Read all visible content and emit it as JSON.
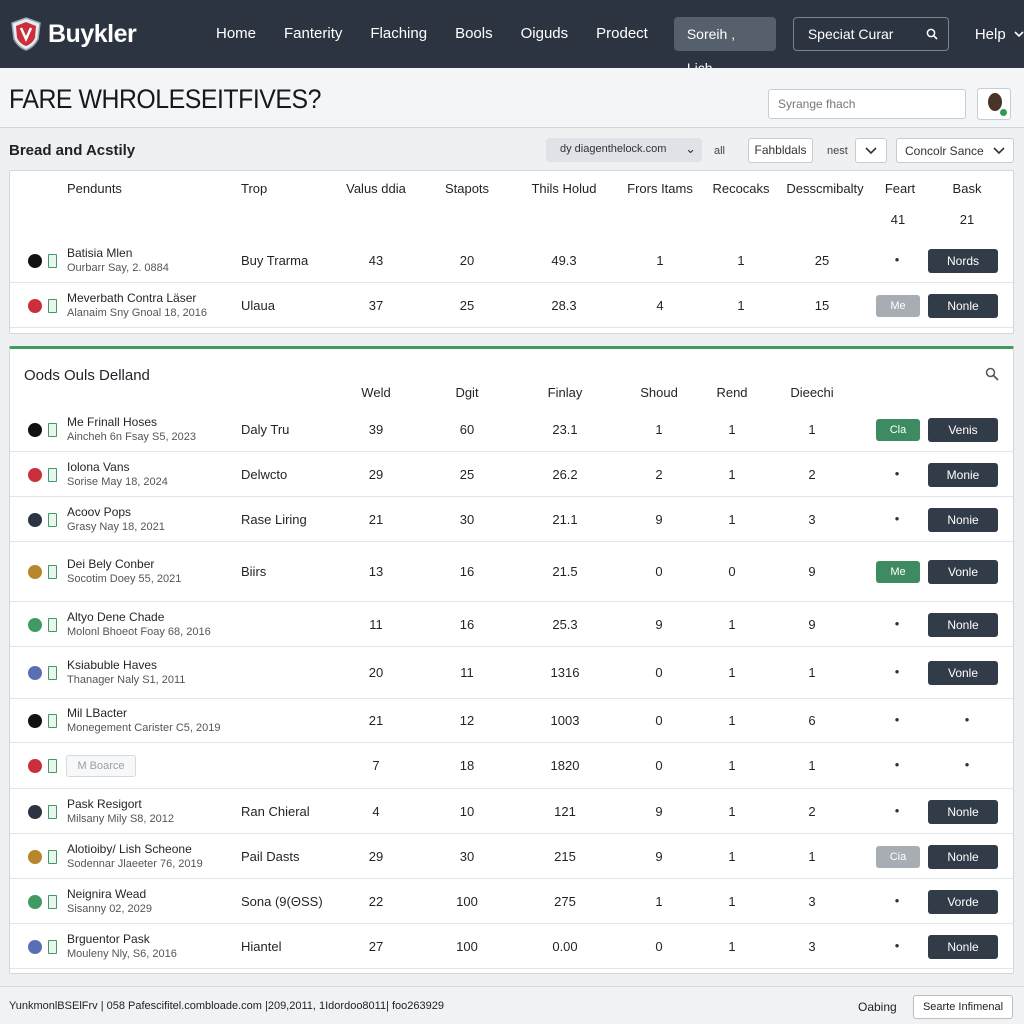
{
  "app": {
    "logo_text": "Buykler"
  },
  "nav": {
    "items": [
      "Home",
      "Fanterity",
      "Flaching",
      "Bools",
      "Oiguds",
      "Prodect"
    ],
    "search_pill": "Soreih , Lich",
    "search_box": "Speciat Curar",
    "help": "Help"
  },
  "header": {
    "title": "FARE WHROLESEITFIVES?",
    "search_placeholder": "Syrange fhach"
  },
  "toolbar": {
    "section_title": "Bread and Acstily",
    "filter_value": "dy diagenthelock.com",
    "label_all": "all",
    "btn_filters": "Fahbldals",
    "label_next": "nest",
    "dropdown_value": "Concolr Sance"
  },
  "table1": {
    "headers": [
      "Pendunts",
      "Trop",
      "Valus ddia",
      "Stapots",
      "Thils Holud",
      "Frors Itams",
      "Recocaks",
      "Desscmibalty",
      "Feart",
      "Bask"
    ],
    "totals": [
      "41",
      "21"
    ],
    "rows": [
      {
        "name": "Batisia Mlen",
        "sub": "Ourbarr Say, 2. 0884",
        "trop": "Buy Trarma",
        "c1": "43",
        "c2": "20",
        "c3": "49.3",
        "c4": "1",
        "c5": "1",
        "c6": "25",
        "mark": "•",
        "tag": "",
        "action": "Nords"
      },
      {
        "name": "Meverbath Contra Läser",
        "sub": "Alanaim Sny Gnoal 18, 2016",
        "trop": "Ulaua",
        "c1": "37",
        "c2": "25",
        "c3": "28.3",
        "c4": "4",
        "c5": "1",
        "c6": "15",
        "mark": "",
        "tag": "Me",
        "action": "Nonle"
      }
    ]
  },
  "table2": {
    "title": "Oods Ouls Delland",
    "headers": [
      "Weld",
      "Dgit",
      "Finlay",
      "Shoud",
      "Rend",
      "Dieechi"
    ],
    "rows": [
      {
        "name": "Me Frinall Hoses",
        "sub": "Aincheh 6n Fsay S5, 2023",
        "trop": "Daly Tru",
        "c1": "39",
        "c2": "60",
        "c3": "23.1",
        "c4": "1",
        "c5": "1",
        "c6": "1",
        "mark": "",
        "tag": "Cla",
        "action": "Venis"
      },
      {
        "name": "Iolona Vans",
        "sub": "Sorise May 18, 2024",
        "trop": "Delwcto",
        "c1": "29",
        "c2": "25",
        "c3": "26.2",
        "c4": "2",
        "c5": "1",
        "c6": "2",
        "mark": "•",
        "tag": "",
        "action": "Monie"
      },
      {
        "name": "Acoov Pops",
        "sub": "Grasy Nay 18, 2021",
        "trop": "Rase Liring",
        "c1": "21",
        "c2": "30",
        "c3": "21.1",
        "c4": "9",
        "c5": "1",
        "c6": "3",
        "mark": "•",
        "tag": "",
        "action": "Nonie"
      },
      {
        "name": "Dei Bely Conber",
        "sub": "Socotim Doey 55, 2021",
        "trop": "Biirs",
        "c1": "13",
        "c2": "16",
        "c3": "21.5",
        "c4": "0",
        "c5": "0",
        "c6": "9",
        "mark": "",
        "tag": "Me",
        "action": "Vonle"
      },
      {
        "name": "Altyo Dene Chade",
        "sub": "Molonl Bhoeot Foay 68, 2016",
        "trop": "",
        "c1": "11",
        "c2": "16",
        "c3": "25.3",
        "c4": "9",
        "c5": "1",
        "c6": "9",
        "mark": "•",
        "tag": "",
        "action": "Nonle"
      },
      {
        "name": "Ksiabuble Haves",
        "sub": "Thanager Naly S1, 2011",
        "trop": "",
        "c1": "20",
        "c2": "11",
        "c3": "1316",
        "c4": "0",
        "c5": "1",
        "c6": "1",
        "mark": "•",
        "tag": "",
        "action": "Vonle"
      },
      {
        "name": "Mil LBacter",
        "sub": "Monegement Carister C5, 2019",
        "trop": "",
        "c1": "21",
        "c2": "12",
        "c3": "1003",
        "c4": "0",
        "c5": "1",
        "c6": "6",
        "mark": "•",
        "tag": "",
        "action": "",
        "action_dot": "•"
      },
      {
        "name": "",
        "sub": "",
        "ghost": "M Boarce",
        "trop": "",
        "c1": "7",
        "c2": "18",
        "c3": "1820",
        "c4": "0",
        "c5": "1",
        "c6": "1",
        "mark": "•",
        "tag": "",
        "action": "",
        "action_dot": "•"
      },
      {
        "name": "Pask Resigort",
        "sub": "Milsany Mily S8, 2012",
        "trop": "Ran Chieral",
        "c1": "4",
        "c2": "10",
        "c3": "121",
        "c4": "9",
        "c5": "1",
        "c6": "2",
        "mark": "•",
        "tag": "",
        "action": "Nonle"
      },
      {
        "name": "Alotioiby/ Lish Scheone",
        "sub": "Sodennar Jlaeeter 76, 2019",
        "trop": "Pail Dasts",
        "c1": "29",
        "c2": "30",
        "c3": "215",
        "c4": "9",
        "c5": "1",
        "c6": "1",
        "mark": "",
        "tag": "Cia",
        "action": "Nonle"
      },
      {
        "name": "Neignira Wead",
        "sub": "Sisanny 02, 2029",
        "trop": "Sona (9(ΘSS)",
        "c1": "22",
        "c2": "100",
        "c3": "275",
        "c4": "1",
        "c5": "1",
        "c6": "3",
        "mark": "•",
        "tag": "",
        "action": "Vorde"
      },
      {
        "name": "Brguentor Pask",
        "sub": "Mouleny Nly, S6, 2016",
        "trop": "Hiantel",
        "c1": "27",
        "c2": "100",
        "c3": "0.00",
        "c4": "0",
        "c5": "1",
        "c6": "3",
        "mark": "•",
        "tag": "",
        "action": "Nonle"
      }
    ]
  },
  "footer": {
    "text": "YunkmonlBSElFrv | 058 Pafescifitel.combloade.com |209,2011, 1Idordoo8011| foo263929",
    "label": "Oabing",
    "button": "Searte Infimenal"
  },
  "colors": {
    "topbar": "#2b3440",
    "accent_green": "#3f9a63",
    "action_button": "#323c48"
  }
}
